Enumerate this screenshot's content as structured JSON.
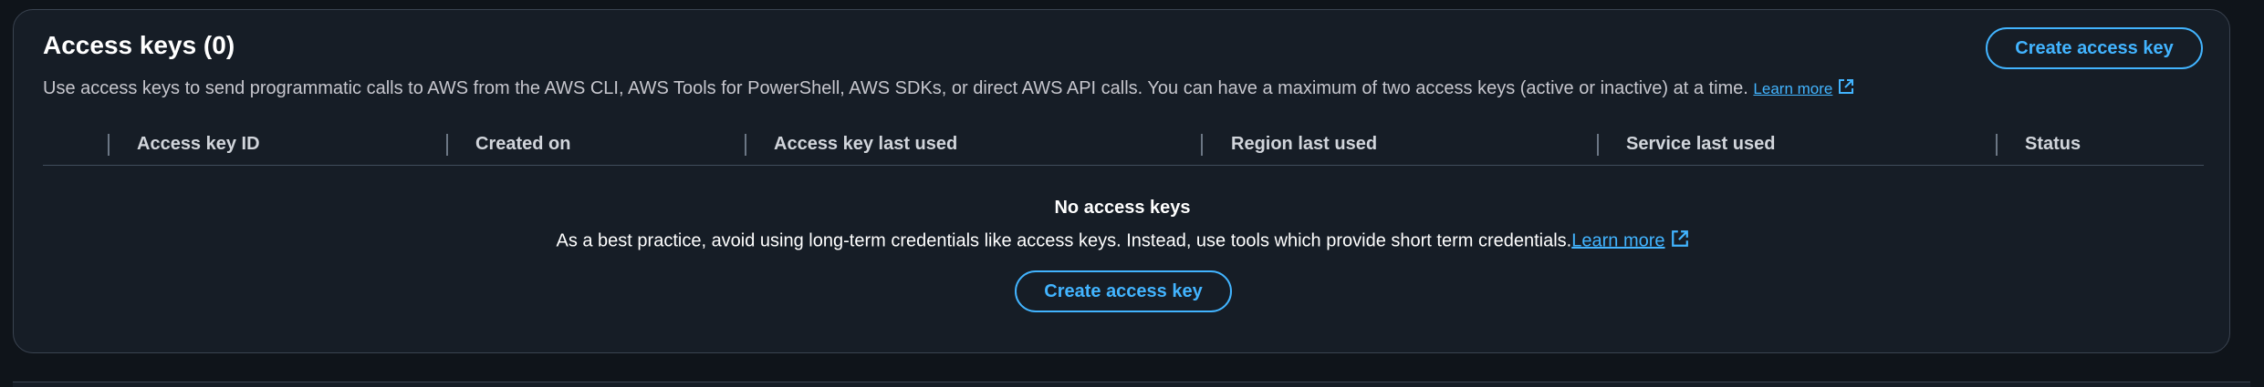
{
  "section": {
    "title": "Access keys (0)",
    "description": "Use access keys to send programmatic calls to AWS from the AWS CLI, AWS Tools for PowerShell, AWS SDKs, or direct AWS API calls. You can have a maximum of two access keys (active or inactive) at a time.",
    "learn_more_label": "Learn more",
    "create_button_label": "Create access key"
  },
  "table": {
    "columns": [
      {
        "label": "Access key ID"
      },
      {
        "label": "Created on"
      },
      {
        "label": "Access key last used"
      },
      {
        "label": "Region last used"
      },
      {
        "label": "Service last used"
      },
      {
        "label": "Status"
      }
    ]
  },
  "empty_state": {
    "title": "No access keys",
    "description": "As a best practice, avoid using long-term credentials like access keys. Instead, use tools which provide short term credentials.",
    "learn_more_label": "Learn more",
    "create_button_label": "Create access key"
  },
  "colors": {
    "accent": "#42b4ff",
    "background": "#161d26",
    "text": "#ffffff"
  },
  "icons": {
    "external_link": "external-link-icon"
  }
}
